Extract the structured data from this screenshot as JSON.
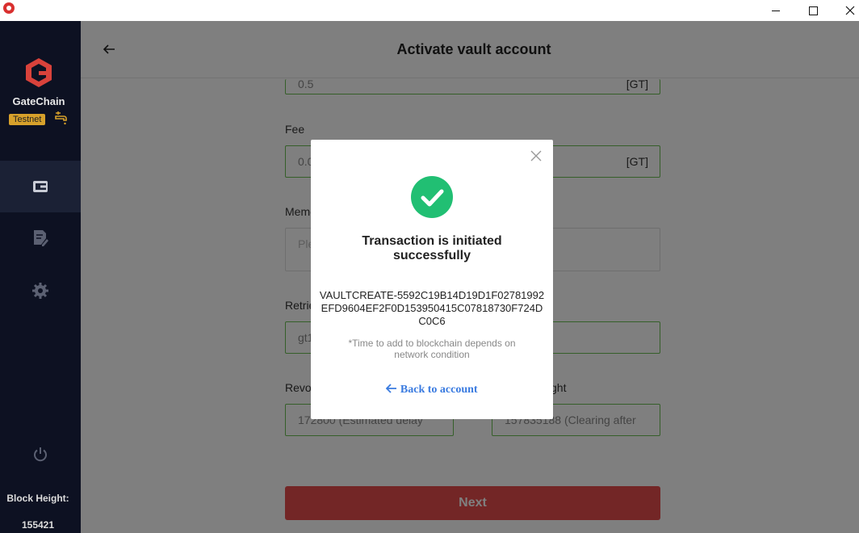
{
  "window": {
    "title": ""
  },
  "sidebar": {
    "brand": "GateChain",
    "network_badge": "Testnet",
    "block_height_label": "Block Height:",
    "block_height_value": "155421",
    "icons": [
      "wallet-icon",
      "records-icon",
      "gear-icon",
      "power-icon"
    ]
  },
  "main": {
    "title": "Activate vault account",
    "amount": {
      "value": "0.5",
      "unit": "[GT]"
    },
    "fee": {
      "label": "Fee",
      "value": "0.0",
      "unit": "[GT]"
    },
    "memo": {
      "label": "Memo",
      "placeholder": "Ple"
    },
    "retrieval": {
      "label": "Retrie",
      "value": "gt1"
    },
    "revocation": {
      "label": "Revo",
      "value": "172800 (Estimated delay"
    },
    "clearing_height": {
      "label": "ght",
      "value": "157835188 (Clearing after"
    },
    "next_label": "Next"
  },
  "modal": {
    "title": "Transaction is initiated successfully",
    "tx_id": "VAULTCREATE-5592C19B14D19D1F02781992EFD9604EF2F0D153950415C07818730F724DC0C6",
    "note": "*Time to add to blockchain depends on network condition",
    "back_label": "Back to account"
  },
  "colors": {
    "sidebar_bg": "#0d1122",
    "accent_green": "#6abf53",
    "success_green": "#21bf73",
    "link_blue": "#3a7be0",
    "badge_gold": "#d7a12b",
    "next_red": "#e74c4c"
  }
}
